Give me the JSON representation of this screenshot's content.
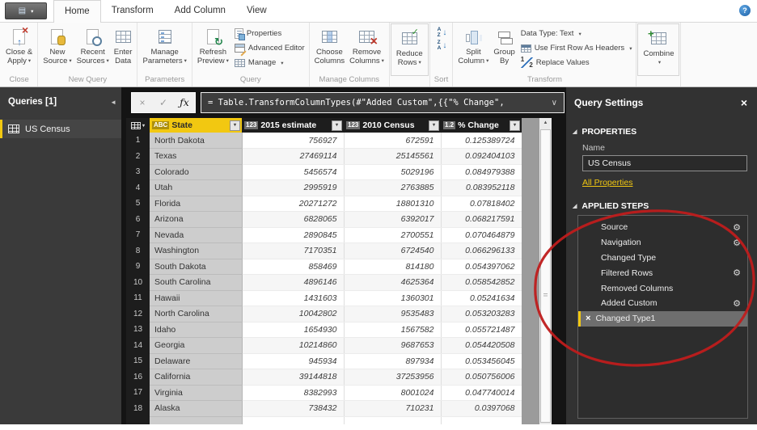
{
  "icons": {
    "menu": "▤",
    "dropdown": "▾",
    "help": "?",
    "collapse": "◄",
    "gear": "⚙",
    "delete": "×",
    "section_triangle": "◢",
    "corner_caret": "▾",
    "scroll_up": "▲"
  },
  "tabbar": {
    "tabs": [
      "Home",
      "Transform",
      "Add Column",
      "View"
    ],
    "active": "Home"
  },
  "ribbon": {
    "groups": [
      {
        "label": "Close",
        "items": [
          {
            "kind": "large",
            "name": "close-and-apply-button",
            "icon": "close-apply",
            "lines": [
              "Close &",
              "Apply"
            ],
            "caret": true
          }
        ]
      },
      {
        "label": "New Query",
        "items": [
          {
            "kind": "large",
            "name": "new-source-button",
            "icon": "new-source",
            "lines": [
              "New",
              "Source"
            ],
            "caret": true
          },
          {
            "kind": "large",
            "name": "recent-sources-button",
            "icon": "recent-sources",
            "lines": [
              "Recent",
              "Sources"
            ],
            "caret": true
          },
          {
            "kind": "large",
            "name": "enter-data-button",
            "icon": "enter-data",
            "lines": [
              "Enter",
              "Data"
            ],
            "caret": false
          }
        ]
      },
      {
        "label": "Parameters",
        "items": [
          {
            "kind": "large",
            "name": "manage-parameters-button",
            "icon": "manage-parameters",
            "lines": [
              "Manage",
              "Parameters"
            ],
            "caret": true
          }
        ]
      },
      {
        "label": "Query",
        "items": [
          {
            "kind": "large",
            "name": "refresh-preview-button",
            "icon": "refresh-preview",
            "lines": [
              "Refresh",
              "Preview"
            ],
            "caret": true
          },
          {
            "kind": "stack",
            "items": [
              {
                "kind": "small",
                "name": "properties-button",
                "icon": "properties",
                "label": "Properties",
                "caret": false
              },
              {
                "kind": "small",
                "name": "advanced-editor-button",
                "icon": "advanced-editor",
                "label": "Advanced Editor",
                "caret": false
              },
              {
                "kind": "small",
                "name": "manage-button",
                "icon": "manage",
                "label": "Manage",
                "caret": true
              }
            ]
          }
        ]
      },
      {
        "label": "Manage Columns",
        "items": [
          {
            "kind": "large",
            "name": "choose-columns-button",
            "icon": "choose-columns",
            "lines": [
              "Choose",
              "Columns"
            ],
            "caret": false
          },
          {
            "kind": "large",
            "name": "remove-columns-button",
            "icon": "remove-columns",
            "lines": [
              "Remove",
              "Columns"
            ],
            "caret": true
          }
        ]
      },
      {
        "label": "",
        "framed": true,
        "items": [
          {
            "kind": "large",
            "name": "reduce-rows-button",
            "icon": "reduce-rows",
            "lines": [
              "Reduce",
              "Rows"
            ],
            "caret": true
          }
        ]
      },
      {
        "label": "Sort",
        "items": [
          {
            "kind": "stack",
            "items": [
              {
                "kind": "sorticon",
                "name": "sort-ascending-button",
                "letters": "AZ",
                "arrow": "↓"
              },
              {
                "kind": "sorticon",
                "name": "sort-descending-button",
                "letters": "ZA",
                "arrow": "↓"
              }
            ]
          }
        ]
      },
      {
        "label": "Transform",
        "items": [
          {
            "kind": "large",
            "name": "split-column-button",
            "icon": "split-column",
            "lines": [
              "Split",
              "Column"
            ],
            "caret": true
          },
          {
            "kind": "large",
            "name": "group-by-button",
            "icon": "group-by",
            "lines": [
              "Group",
              "By"
            ],
            "caret": false
          },
          {
            "kind": "stack",
            "items": [
              {
                "kind": "small",
                "name": "data-type-button",
                "icon": null,
                "label": "Data Type: Text",
                "caret": true
              },
              {
                "kind": "small",
                "name": "use-first-row-as-headers-button",
                "icon": "first-row-headers",
                "label": "Use First Row As Headers",
                "caret": true
              },
              {
                "kind": "small",
                "name": "replace-values-button",
                "icon": "replace-values",
                "label": "Replace Values",
                "caret": false
              }
            ]
          }
        ]
      },
      {
        "label": "",
        "framed": true,
        "items": [
          {
            "kind": "large",
            "name": "combine-button",
            "icon": "combine",
            "lines": [
              "Combine"
            ],
            "caret": true
          }
        ]
      }
    ]
  },
  "queries_panel": {
    "title": "Queries [1]",
    "items": [
      {
        "label": "US Census",
        "selected": true
      }
    ]
  },
  "formula_bar": {
    "cancel_icon": "×",
    "check_icon": "✓",
    "fx_icon": "ƒx",
    "expand_icon": "∨",
    "formula": "= Table.TransformColumnTypes(#\"Added Custom\",{{\"% Change\","
  },
  "table": {
    "filter_icon": "▾",
    "columns": [
      {
        "badge": "ABC",
        "label": "State",
        "selected": true
      },
      {
        "badge": "123",
        "label": "2015 estimate",
        "selected": false
      },
      {
        "badge": "123",
        "label": "2010 Census",
        "selected": false
      },
      {
        "badge": "1.2",
        "label": "% Change",
        "selected": false
      }
    ],
    "rows": [
      {
        "n": "1",
        "state": "North Dakota",
        "est": "756927",
        "census": "672591",
        "pct": "0.125389724"
      },
      {
        "n": "2",
        "state": "Texas",
        "est": "27469114",
        "census": "25145561",
        "pct": "0.092404103"
      },
      {
        "n": "3",
        "state": "Colorado",
        "est": "5456574",
        "census": "5029196",
        "pct": "0.084979388"
      },
      {
        "n": "4",
        "state": "Utah",
        "est": "2995919",
        "census": "2763885",
        "pct": "0.083952118"
      },
      {
        "n": "5",
        "state": "Florida",
        "est": "20271272",
        "census": "18801310",
        "pct": "0.07818402"
      },
      {
        "n": "6",
        "state": "Arizona",
        "est": "6828065",
        "census": "6392017",
        "pct": "0.068217591"
      },
      {
        "n": "7",
        "state": "Nevada",
        "est": "2890845",
        "census": "2700551",
        "pct": "0.070464879"
      },
      {
        "n": "8",
        "state": "Washington",
        "est": "7170351",
        "census": "6724540",
        "pct": "0.066296133"
      },
      {
        "n": "9",
        "state": "South Dakota",
        "est": "858469",
        "census": "814180",
        "pct": "0.054397062"
      },
      {
        "n": "10",
        "state": "South Carolina",
        "est": "4896146",
        "census": "4625364",
        "pct": "0.058542852"
      },
      {
        "n": "11",
        "state": "Hawaii",
        "est": "1431603",
        "census": "1360301",
        "pct": "0.05241634"
      },
      {
        "n": "12",
        "state": "North Carolina",
        "est": "10042802",
        "census": "9535483",
        "pct": "0.053203283"
      },
      {
        "n": "13",
        "state": "Idaho",
        "est": "1654930",
        "census": "1567582",
        "pct": "0.055721487"
      },
      {
        "n": "14",
        "state": "Georgia",
        "est": "10214860",
        "census": "9687653",
        "pct": "0.054420508"
      },
      {
        "n": "15",
        "state": "Delaware",
        "est": "945934",
        "census": "897934",
        "pct": "0.053456045"
      },
      {
        "n": "16",
        "state": "California",
        "est": "39144818",
        "census": "37253956",
        "pct": "0.050756006"
      },
      {
        "n": "17",
        "state": "Virginia",
        "est": "8382993",
        "census": "8001024",
        "pct": "0.047740014"
      },
      {
        "n": "18",
        "state": "Alaska",
        "est": "738432",
        "census": "710231",
        "pct": "0.0397068"
      }
    ]
  },
  "query_settings": {
    "title": "Query Settings",
    "properties_header": "PROPERTIES",
    "name_label": "Name",
    "name_value": "US Census",
    "all_properties_label": "All Properties",
    "applied_steps_header": "APPLIED STEPS",
    "steps": [
      {
        "label": "Source",
        "gear": true,
        "selected": false
      },
      {
        "label": "Navigation",
        "gear": true,
        "selected": false
      },
      {
        "label": "Changed Type",
        "gear": false,
        "selected": false
      },
      {
        "label": "Filtered Rows",
        "gear": true,
        "selected": false
      },
      {
        "label": "Removed Columns",
        "gear": false,
        "selected": false
      },
      {
        "label": "Added Custom",
        "gear": true,
        "selected": false
      },
      {
        "label": "Changed Type1",
        "gear": false,
        "selected": true
      }
    ]
  },
  "annotation": {
    "color": "#bf1c1c"
  }
}
